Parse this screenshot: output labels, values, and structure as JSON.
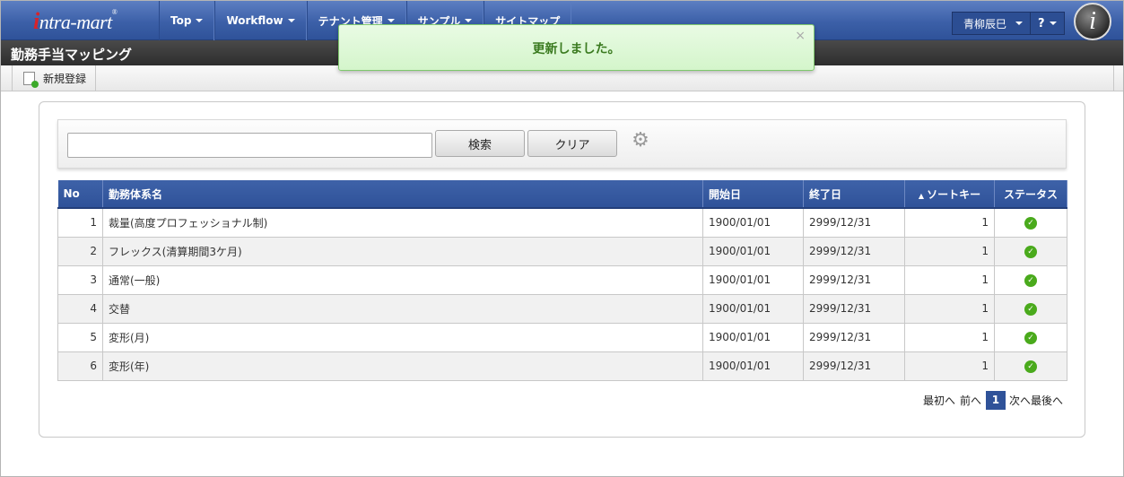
{
  "header": {
    "logo_text": "ntra-mart",
    "logo_letter": "i",
    "nav": [
      {
        "label": "Top"
      },
      {
        "label": "Workflow"
      },
      {
        "label": "テナント管理"
      },
      {
        "label": "サンプル"
      },
      {
        "label": "サイトマップ"
      }
    ],
    "user_name": "青柳辰巳",
    "help_label": "?",
    "avatar_letter": "i"
  },
  "page_title": "勤務手当マッピング",
  "toolbar": {
    "new_label": "新規登録"
  },
  "toast": {
    "message": "更新しました。",
    "close": "×"
  },
  "search": {
    "value": "",
    "search_label": "検索",
    "clear_label": "クリア"
  },
  "table": {
    "headers": [
      "No",
      "勤務体系名",
      "開始日",
      "終了日",
      "ソートキー",
      "ステータス"
    ],
    "rows": [
      {
        "no": "1",
        "name": "裁量(高度プロフェッショナル制)",
        "start": "1900/01/01",
        "end": "2999/12/31",
        "sort": "1"
      },
      {
        "no": "2",
        "name": "フレックス(清算期間3ケ月)",
        "start": "1900/01/01",
        "end": "2999/12/31",
        "sort": "1"
      },
      {
        "no": "3",
        "name": "通常(一般)",
        "start": "1900/01/01",
        "end": "2999/12/31",
        "sort": "1"
      },
      {
        "no": "4",
        "name": "交替",
        "start": "1900/01/01",
        "end": "2999/12/31",
        "sort": "1"
      },
      {
        "no": "5",
        "name": "変形(月)",
        "start": "1900/01/01",
        "end": "2999/12/31",
        "sort": "1"
      },
      {
        "no": "6",
        "name": "変形(年)",
        "start": "1900/01/01",
        "end": "2999/12/31",
        "sort": "1"
      }
    ]
  },
  "pager": {
    "first": "最初へ",
    "prev": "前へ",
    "current": "1",
    "next": "次へ",
    "last": "最後へ"
  },
  "colors": {
    "header_blue": "#3c60a8",
    "toast_green": "#3a7a1f",
    "status_green": "#4aaa1c"
  }
}
